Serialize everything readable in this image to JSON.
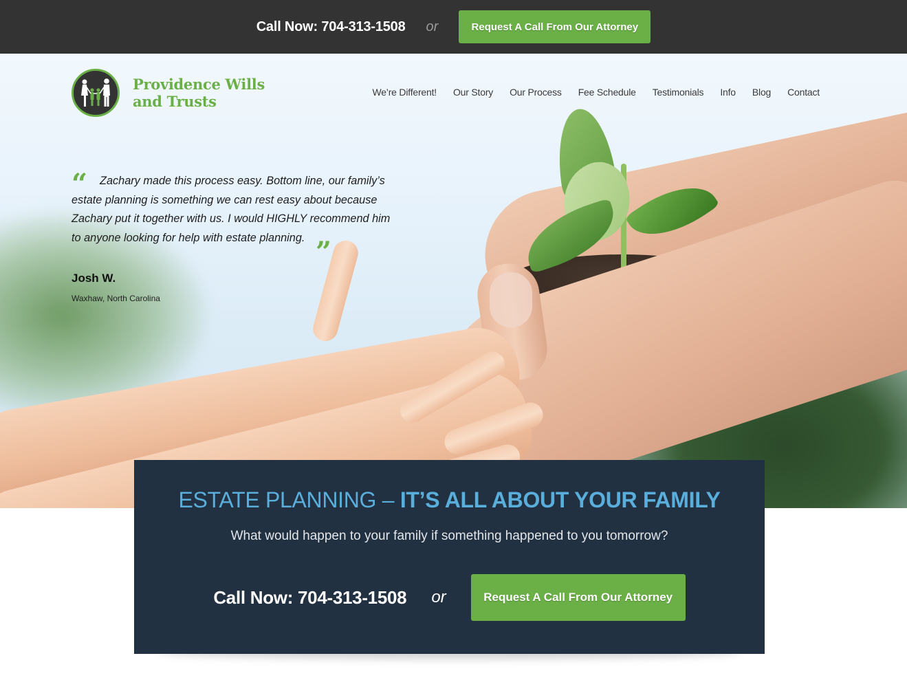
{
  "topbar": {
    "call_label": "Call Now: 704-313-1508",
    "or_label": "or",
    "request_button": "Request A Call From Our Attorney"
  },
  "brand": {
    "name_line1": "Providence Wills",
    "name_line2": "and Trusts",
    "logo_icon": "family-silhouette-icon",
    "accent_color": "#6ab046",
    "dark_color": "#333333"
  },
  "nav": {
    "items": [
      {
        "label": "We’re Different!"
      },
      {
        "label": "Our Story"
      },
      {
        "label": "Our Process"
      },
      {
        "label": "Fee Schedule"
      },
      {
        "label": "Testimonials"
      },
      {
        "label": "Info"
      },
      {
        "label": "Blog"
      },
      {
        "label": "Contact"
      }
    ]
  },
  "testimonial": {
    "open_quote": "“",
    "close_quote": "”",
    "text": "Zachary made this process easy. Bottom line, our family’s estate planning is something we can rest easy about because Zachary put it together with us. I would HIGHLY recommend him to anyone looking for help with estate planning.",
    "author": "Josh W.",
    "location": "Waxhaw, North Carolina"
  },
  "cta": {
    "title_light": "ESTATE PLANNING – ",
    "title_bold": "IT’S ALL ABOUT YOUR FAMILY",
    "subtitle": "What would happen to your family if something happened to you tomorrow?",
    "call_label": "Call Now: 704-313-1508",
    "or_label": "or",
    "request_button": "Request A Call From Our Attorney",
    "background_color": "#223142",
    "title_color": "#5aaedb"
  }
}
